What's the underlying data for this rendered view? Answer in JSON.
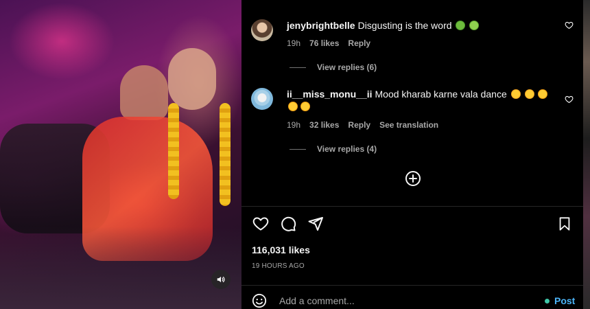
{
  "comments": [
    {
      "username": "jenybrightbelle",
      "text": "Disgusting is the word",
      "emojis": [
        "nauseated-face",
        "face-vomiting"
      ],
      "time": "19h",
      "likes": "76 likes",
      "reply": "Reply",
      "view_replies": "View replies (6)"
    },
    {
      "username": "ii__miss_monu__ii",
      "text": "Mood kharab karne vala dance",
      "emojis": [
        "tired-face",
        "tired-face",
        "rolling-laughing",
        "rolling-laughing",
        "rolling-laughing"
      ],
      "time": "19h",
      "likes": "32 likes",
      "reply": "Reply",
      "translate": "See translation",
      "view_replies": "View replies (4)"
    }
  ],
  "post": {
    "likes": "116,031 likes",
    "time": "19 HOURS AGO"
  },
  "comment_box": {
    "placeholder": "Add a comment...",
    "post_label": "Post"
  },
  "colors": {
    "background": "#000000",
    "text": "#f5f5f5",
    "secondary_text": "#a8a8a8",
    "post_button": "#4cb5f9"
  }
}
